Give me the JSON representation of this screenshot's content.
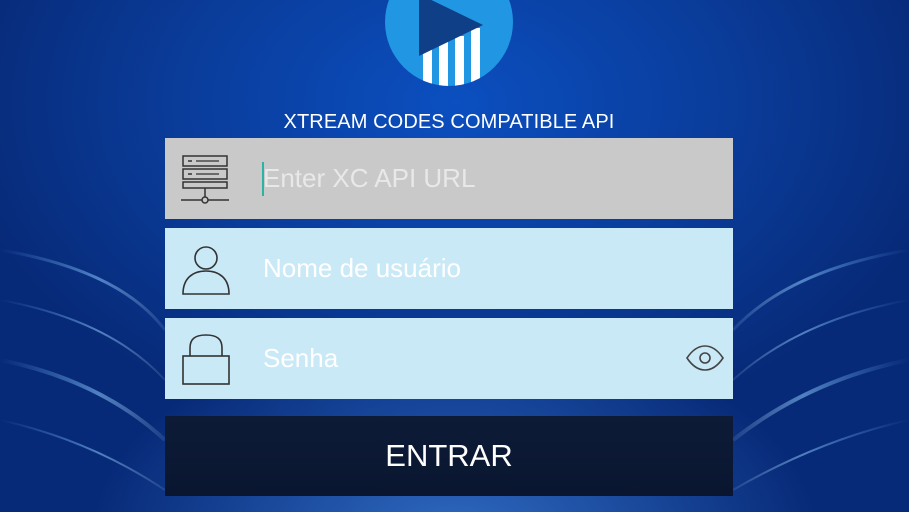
{
  "app": {
    "subtitle": "XTREAM CODES COMPATIBLE API"
  },
  "form": {
    "url_placeholder": "Enter XC API URL",
    "username_placeholder": "Nome de usuário",
    "password_placeholder": "Senha",
    "submit_label": "ENTRAR"
  },
  "icons": {
    "logo": "play-logo-icon",
    "url": "server-icon",
    "username": "user-icon",
    "password": "lock-icon",
    "toggle_password": "eye-icon"
  },
  "colors": {
    "background": "#0a3f9e",
    "logo": "#2196e3",
    "url_field": "#c9c9c9",
    "input_field": "#c9e9f7",
    "button": "#0d1b37",
    "caret": "#2bb3a5"
  }
}
